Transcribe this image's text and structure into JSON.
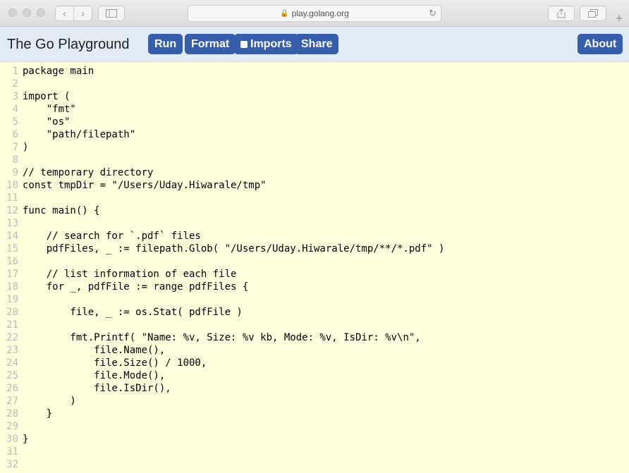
{
  "browser": {
    "url": "play.golang.org"
  },
  "header": {
    "title": "The Go Playground",
    "run_label": "Run",
    "format_label": "Format",
    "imports_label": "Imports",
    "share_label": "Share",
    "about_label": "About"
  },
  "editor": {
    "lines": [
      {
        "n": "1",
        "text": "package main"
      },
      {
        "n": "2",
        "text": ""
      },
      {
        "n": "3",
        "text": "import ("
      },
      {
        "n": "4",
        "text": "    \"fmt\""
      },
      {
        "n": "5",
        "text": "    \"os\""
      },
      {
        "n": "6",
        "text": "    \"path/filepath\""
      },
      {
        "n": "7",
        "text": ")"
      },
      {
        "n": "8",
        "text": ""
      },
      {
        "n": "9",
        "text": "// temporary directory"
      },
      {
        "n": "10",
        "text": "const tmpDir = \"/Users/Uday.Hiwarale/tmp\""
      },
      {
        "n": "11",
        "text": ""
      },
      {
        "n": "12",
        "text": "func main() {"
      },
      {
        "n": "13",
        "text": ""
      },
      {
        "n": "14",
        "text": "    // search for `.pdf` files"
      },
      {
        "n": "15",
        "text": "    pdfFiles, _ := filepath.Glob( \"/Users/Uday.Hiwarale/tmp/**/*.pdf\" )"
      },
      {
        "n": "16",
        "text": ""
      },
      {
        "n": "17",
        "text": "    // list information of each file"
      },
      {
        "n": "18",
        "text": "    for _, pdfFile := range pdfFiles {"
      },
      {
        "n": "19",
        "text": ""
      },
      {
        "n": "20",
        "text": "        file, _ := os.Stat( pdfFile )"
      },
      {
        "n": "21",
        "text": ""
      },
      {
        "n": "22",
        "text": "        fmt.Printf( \"Name: %v, Size: %v kb, Mode: %v, IsDir: %v\\n\","
      },
      {
        "n": "23",
        "text": "            file.Name(),"
      },
      {
        "n": "24",
        "text": "            file.Size() / 1000,"
      },
      {
        "n": "25",
        "text": "            file.Mode(),"
      },
      {
        "n": "26",
        "text": "            file.IsDir(),"
      },
      {
        "n": "27",
        "text": "        )"
      },
      {
        "n": "28",
        "text": "    }"
      },
      {
        "n": "29",
        "text": ""
      },
      {
        "n": "30",
        "text": "}"
      },
      {
        "n": "31",
        "text": ""
      },
      {
        "n": "32",
        "text": ""
      }
    ]
  }
}
